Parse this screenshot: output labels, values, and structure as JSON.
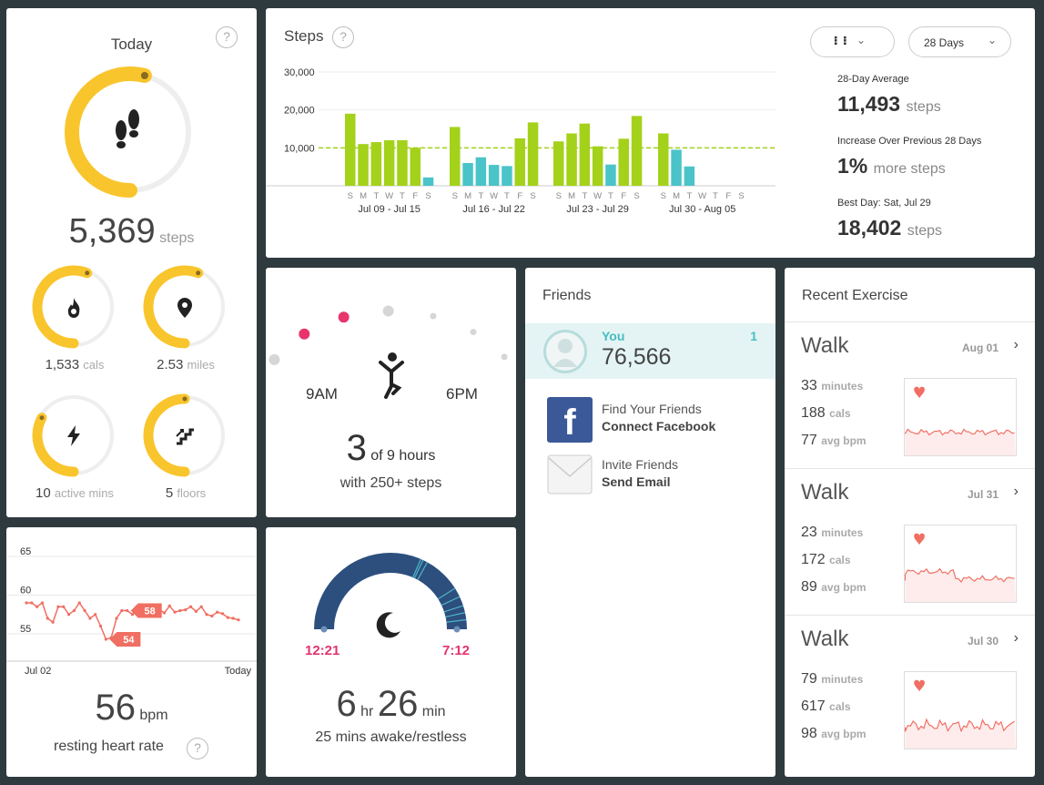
{
  "today": {
    "title": "Today",
    "help": "?",
    "steps_value": "5,369",
    "steps_unit": "steps",
    "steps_progress": 0.54,
    "mini": [
      {
        "value": "1,533",
        "unit": "cals",
        "icon": "flame-icon",
        "progress": 0.56
      },
      {
        "value": "2.53",
        "unit": "miles",
        "icon": "location-pin-icon",
        "progress": 0.56
      },
      {
        "value": "10",
        "unit": "active mins",
        "icon": "lightning-icon",
        "progress": 0.33
      },
      {
        "value": "5",
        "unit": "floors",
        "icon": "stairs-icon",
        "progress": 0.5
      }
    ]
  },
  "steps_chart": {
    "title": "Steps",
    "help": "?",
    "icon_dropdown": "footprint-icon",
    "range_dropdown": "28 Days",
    "stats": [
      {
        "label": "28-Day Average",
        "value": "11,493",
        "unit": "steps"
      },
      {
        "label": "Increase Over Previous 28 Days",
        "value": "1%",
        "unit": "more steps"
      },
      {
        "label": "Best Day: Sat, Jul 29",
        "value": "18,402",
        "unit": "steps"
      }
    ]
  },
  "chart_data": {
    "type": "bar",
    "ylim": [
      0,
      30000
    ],
    "yticks": [
      "30,000",
      "20,000",
      "10,000"
    ],
    "goal": 10000,
    "day_letters": [
      "S",
      "M",
      "T",
      "W",
      "T",
      "F",
      "S"
    ],
    "weeks": [
      {
        "label": "Jul 09 - Jul 15",
        "values": [
          19000,
          11000,
          11500,
          12000,
          12000,
          10000,
          2200
        ]
      },
      {
        "label": "Jul 16 - Jul 22",
        "values": [
          15500,
          6000,
          7500,
          5500,
          5200,
          12500,
          16700
        ]
      },
      {
        "label": "Jul 23 - Jul 29",
        "values": [
          11700,
          13800,
          16400,
          10400,
          5600,
          12400,
          18402
        ]
      },
      {
        "label": "Jul 30 - Aug 05",
        "values": [
          13800,
          9500,
          5100,
          null,
          null,
          null,
          null
        ]
      }
    ],
    "colors": {
      "above_goal": "#a4d11a",
      "below_goal": "#4ac4c9",
      "goal_line": "#a4d11a"
    }
  },
  "hourly": {
    "start": "9AM",
    "end": "6PM",
    "hours_value": "3",
    "hours_text": "of 9 hours",
    "sub": "with 250+ steps",
    "dots_active": [
      true,
      false,
      true,
      true,
      false,
      false,
      false,
      false,
      false
    ]
  },
  "friends": {
    "title": "Friends",
    "you_label": "You",
    "you_steps": "76,566",
    "you_rank": "1",
    "links": [
      {
        "line1": "Find Your Friends",
        "line2": "Connect Facebook",
        "icon": "facebook-icon"
      },
      {
        "line1": "Invite Friends",
        "line2": "Send Email",
        "icon": "envelope-icon"
      }
    ]
  },
  "exercise": {
    "title": "Recent Exercise",
    "items": [
      {
        "name": "Walk",
        "date": "Aug 01",
        "minutes": "33",
        "cals": "188",
        "bpm": "77",
        "min_u": "minutes",
        "cal_u": "cals",
        "bpm_u": "avg bpm"
      },
      {
        "name": "Walk",
        "date": "Jul 31",
        "minutes": "23",
        "cals": "172",
        "bpm": "89",
        "min_u": "minutes",
        "cal_u": "cals",
        "bpm_u": "avg bpm"
      },
      {
        "name": "Walk",
        "date": "Jul 30",
        "minutes": "79",
        "cals": "617",
        "bpm": "98",
        "min_u": "minutes",
        "cal_u": "cals",
        "bpm_u": "avg bpm"
      }
    ]
  },
  "heart": {
    "yticks": [
      "65",
      "60",
      "55"
    ],
    "x_start": "Jul 02",
    "x_end": "Today",
    "high_label": "58",
    "low_label": "54",
    "value": "56",
    "unit": "bpm",
    "caption": "resting heart rate",
    "help": "?"
  },
  "sleep": {
    "start": "12:21",
    "end": "7:12",
    "hours": "6",
    "hr_unit": "hr",
    "minutes": "26",
    "min_unit": "min",
    "sub": "25 mins awake/restless"
  }
}
